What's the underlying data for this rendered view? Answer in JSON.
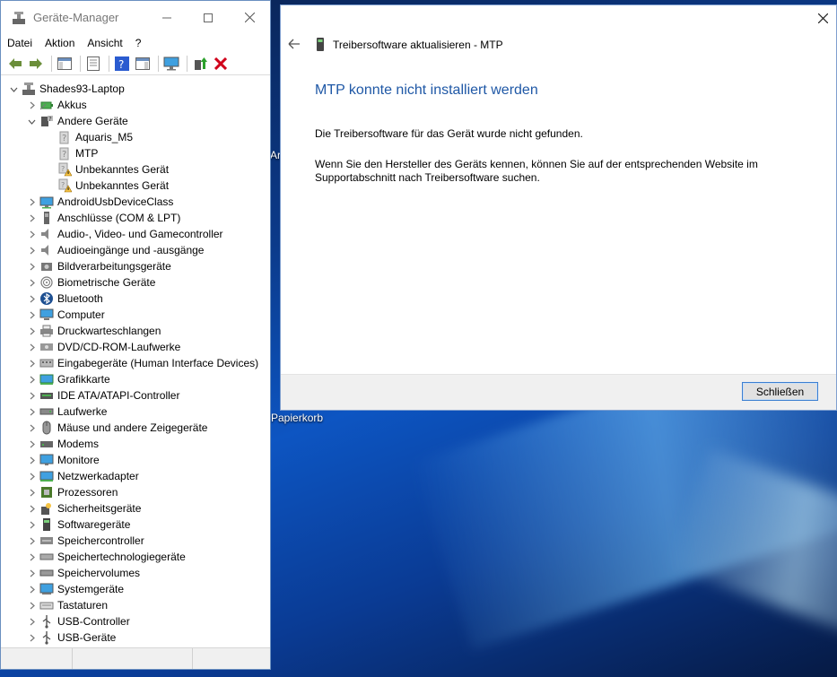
{
  "device_manager": {
    "title": "Geräte-Manager",
    "menu": [
      "Datei",
      "Aktion",
      "Ansicht",
      "?"
    ],
    "root": "Shades93-Laptop",
    "tree": [
      {
        "label": "Akkus",
        "level": 1,
        "expanded": false,
        "icon": "battery-icon"
      },
      {
        "label": "Andere Geräte",
        "level": 1,
        "expanded": true,
        "icon": "other-devices-icon"
      },
      {
        "label": "Aquaris_M5",
        "level": 2,
        "icon": "unknown-device-icon"
      },
      {
        "label": "MTP",
        "level": 2,
        "icon": "unknown-device-icon"
      },
      {
        "label": "Unbekanntes Gerät",
        "level": 2,
        "icon": "warning-device-icon"
      },
      {
        "label": "Unbekanntes Gerät",
        "level": 2,
        "icon": "warning-device-icon"
      },
      {
        "label": "AndroidUsbDeviceClass",
        "level": 1,
        "expanded": false,
        "icon": "android-icon"
      },
      {
        "label": "Anschlüsse (COM & LPT)",
        "level": 1,
        "expanded": false,
        "icon": "port-icon"
      },
      {
        "label": "Audio-, Video- und Gamecontroller",
        "level": 1,
        "expanded": false,
        "icon": "speaker-icon"
      },
      {
        "label": "Audioeingänge und -ausgänge",
        "level": 1,
        "expanded": false,
        "icon": "speaker-icon"
      },
      {
        "label": "Bildverarbeitungsgeräte",
        "level": 1,
        "expanded": false,
        "icon": "camera-icon"
      },
      {
        "label": "Biometrische Geräte",
        "level": 1,
        "expanded": false,
        "icon": "fingerprint-icon"
      },
      {
        "label": "Bluetooth",
        "level": 1,
        "expanded": false,
        "icon": "bluetooth-icon"
      },
      {
        "label": "Computer",
        "level": 1,
        "expanded": false,
        "icon": "computer-icon"
      },
      {
        "label": "Druckwarteschlangen",
        "level": 1,
        "expanded": false,
        "icon": "printer-icon"
      },
      {
        "label": "DVD/CD-ROM-Laufwerke",
        "level": 1,
        "expanded": false,
        "icon": "disc-icon"
      },
      {
        "label": "Eingabegeräte (Human Interface Devices)",
        "level": 1,
        "expanded": false,
        "icon": "hid-icon"
      },
      {
        "label": "Grafikkarte",
        "level": 1,
        "expanded": false,
        "icon": "display-adapter-icon"
      },
      {
        "label": "IDE ATA/ATAPI-Controller",
        "level": 1,
        "expanded": false,
        "icon": "ide-icon"
      },
      {
        "label": "Laufwerke",
        "level": 1,
        "expanded": false,
        "icon": "drive-icon"
      },
      {
        "label": "Mäuse und andere Zeigegeräte",
        "level": 1,
        "expanded": false,
        "icon": "mouse-icon"
      },
      {
        "label": "Modems",
        "level": 1,
        "expanded": false,
        "icon": "modem-icon"
      },
      {
        "label": "Monitore",
        "level": 1,
        "expanded": false,
        "icon": "monitor-icon"
      },
      {
        "label": "Netzwerkadapter",
        "level": 1,
        "expanded": false,
        "icon": "network-icon"
      },
      {
        "label": "Prozessoren",
        "level": 1,
        "expanded": false,
        "icon": "cpu-icon"
      },
      {
        "label": "Sicherheitsgeräte",
        "level": 1,
        "expanded": false,
        "icon": "security-icon"
      },
      {
        "label": "Softwaregeräte",
        "level": 1,
        "expanded": false,
        "icon": "software-device-icon"
      },
      {
        "label": "Speichercontroller",
        "level": 1,
        "expanded": false,
        "icon": "storage-controller-icon"
      },
      {
        "label": "Speichertechnologiegeräte",
        "level": 1,
        "expanded": false,
        "icon": "storage-tech-icon"
      },
      {
        "label": "Speichervolumes",
        "level": 1,
        "expanded": false,
        "icon": "volume-icon"
      },
      {
        "label": "Systemgeräte",
        "level": 1,
        "expanded": false,
        "icon": "system-icon"
      },
      {
        "label": "Tastaturen",
        "level": 1,
        "expanded": false,
        "icon": "keyboard-icon"
      },
      {
        "label": "USB-Controller",
        "level": 1,
        "expanded": false,
        "icon": "usb-icon"
      },
      {
        "label": "USB-Geräte",
        "level": 1,
        "expanded": false,
        "icon": "usb-icon"
      }
    ]
  },
  "dialog": {
    "header": "Treibersoftware aktualisieren - MTP",
    "heading": "MTP konnte nicht installiert werden",
    "message1": "Die Treibersoftware für das Gerät wurde nicht gefunden.",
    "message2": "Wenn Sie den Hersteller des Geräts kennen, können Sie auf der entsprechenden Website im Supportabschnitt nach Treibersoftware suchen.",
    "close_button": "Schließen"
  },
  "desktop": {
    "recycle_bin_label": "Papierkorb",
    "partial_label": "Ar"
  },
  "colors": {
    "heading_blue": "#1f58a6",
    "delete_red": "#d0021b",
    "desktop_blue": "#0d55c2"
  }
}
